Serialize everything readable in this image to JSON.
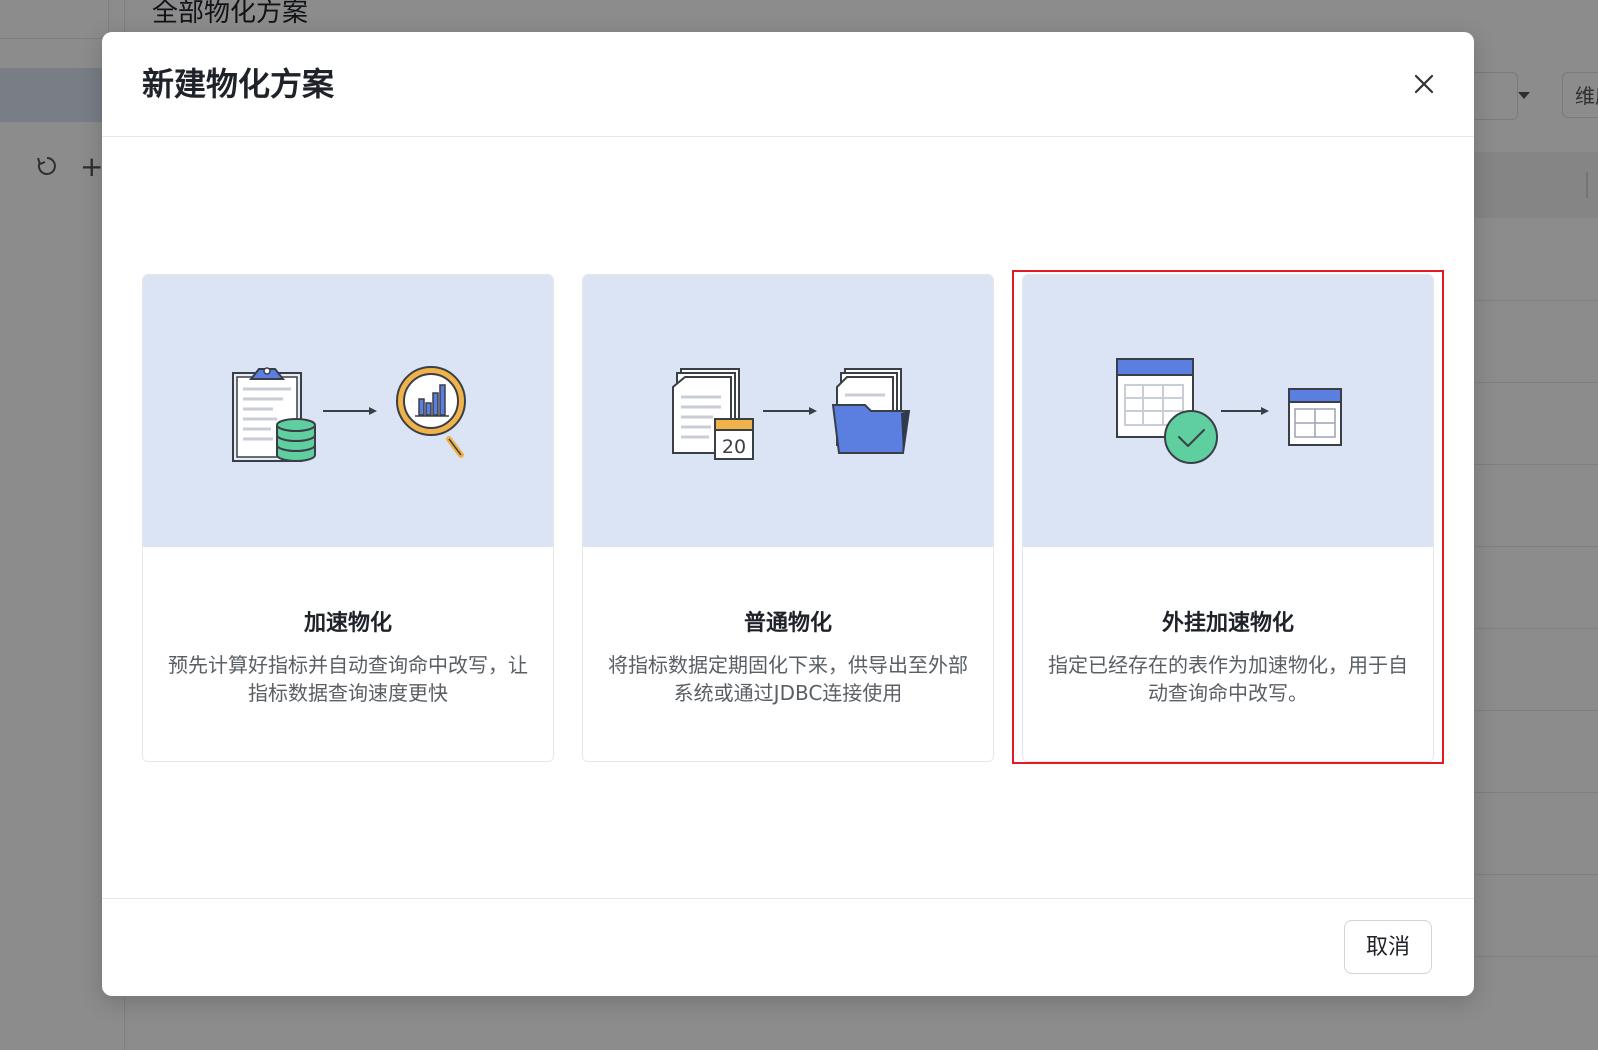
{
  "background": {
    "page_title": "全部物化方案",
    "right_button_label": "维度"
  },
  "dialog": {
    "title": "新建物化方案",
    "cancel_label": "取消",
    "cards": [
      {
        "title": "加速物化",
        "description": "预先计算好指标并自动查询命中改写，让指标数据查询速度更快"
      },
      {
        "title": "普通物化",
        "description": "将指标数据定期固化下来，供导出至外部系统或通过JDBC连接使用",
        "calendar_number": "20"
      },
      {
        "title": "外挂加速物化",
        "description": "指定已经存在的表作为加速物化，用于自动查询命中改写。",
        "highlighted": true
      }
    ]
  },
  "colors": {
    "illustration_bg": "#dbe4f4",
    "accent_blue": "#5a7fe0",
    "accent_green": "#5fcfa0",
    "accent_orange": "#f0b34a",
    "highlight_red": "#e01b22"
  }
}
